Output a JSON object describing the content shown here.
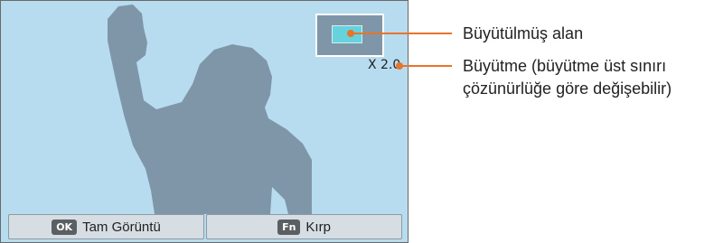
{
  "screen": {
    "zoom_value": "X 2.0",
    "bottom_bar": {
      "left": {
        "key": "OK",
        "label": "Tam Görüntü"
      },
      "right": {
        "key": "Fn",
        "label": "Kırp"
      }
    }
  },
  "callouts": {
    "magnified_area": "Büyütülmüş alan",
    "magnification_line1": "Büyütme (büyütme üst sınırı",
    "magnification_line2": "çözünürlüğe göre değişebilir)"
  },
  "colors": {
    "screen_bg": "#b7dcf0",
    "silhouette": "#7f96a8",
    "callout_accent": "#e8742a",
    "magnified_area": "#66d2de"
  }
}
